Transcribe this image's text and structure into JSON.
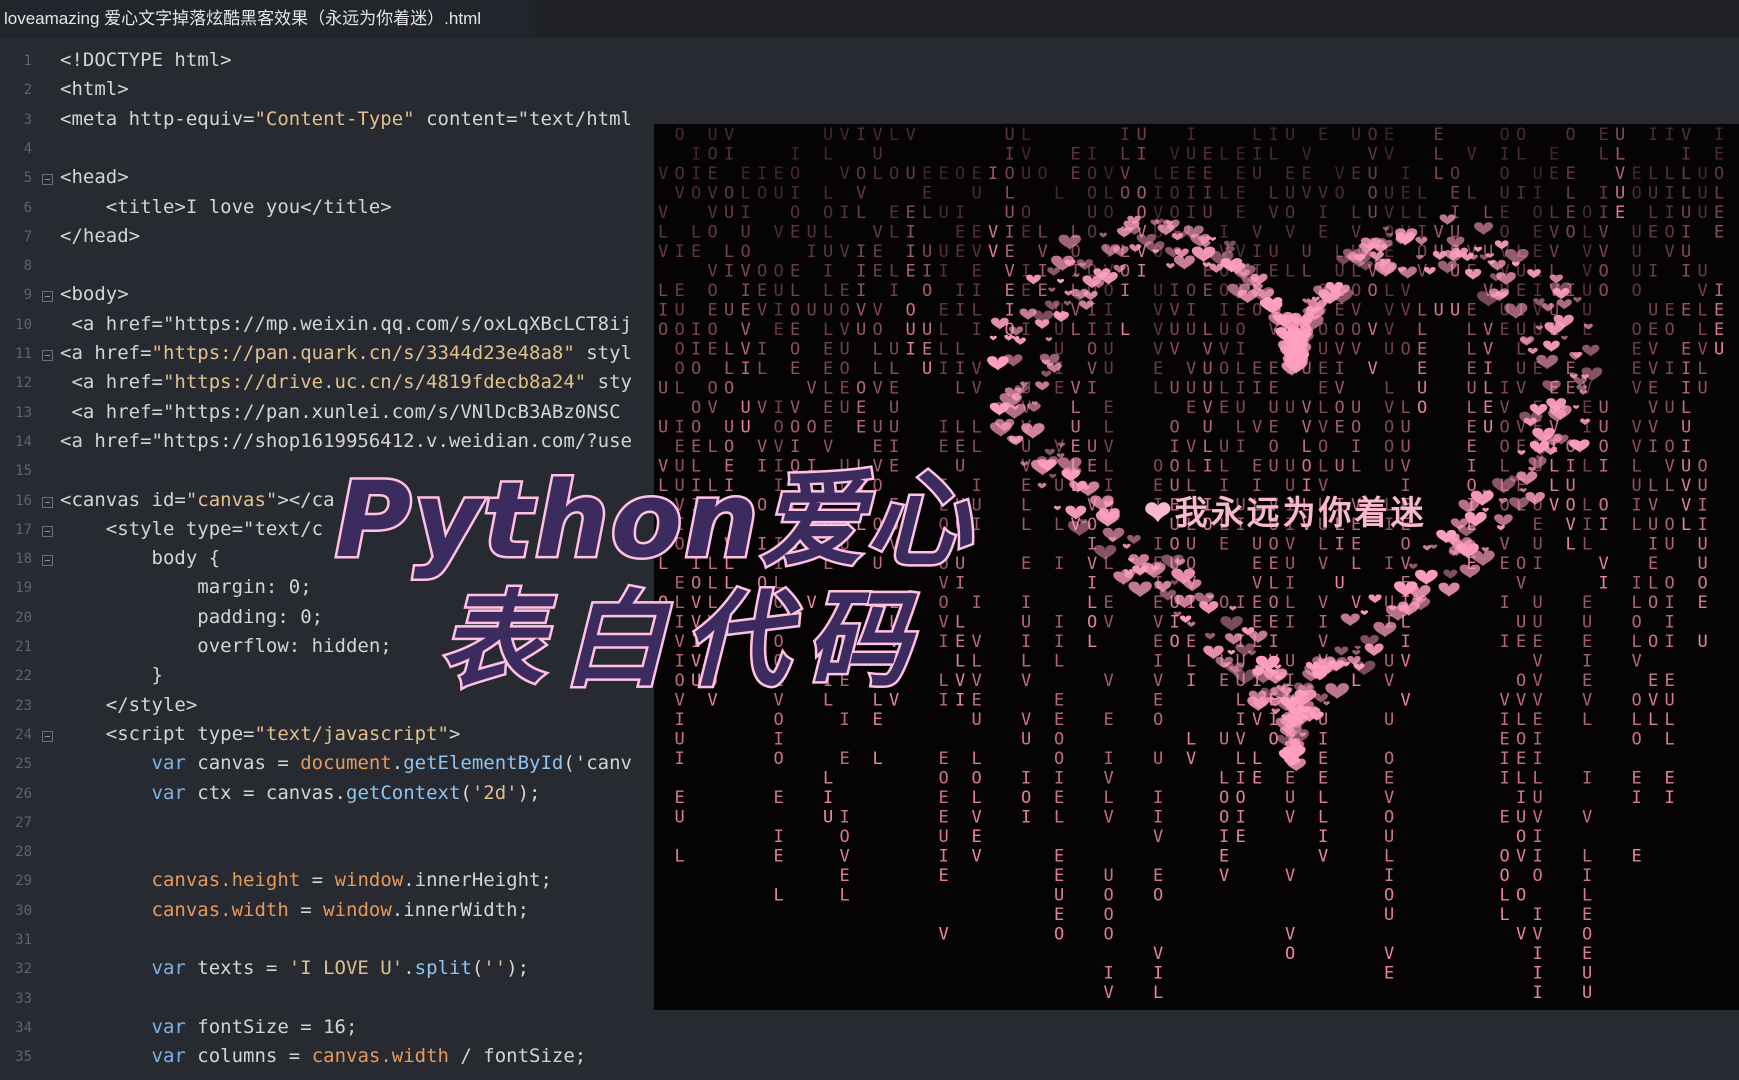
{
  "tab": {
    "title": "loveamazing 爱心文字掉落炫酷黑客效果（永远为你着迷）.html"
  },
  "code_lines": [
    {
      "n": "1",
      "t": "<!DOCTYPE html>"
    },
    {
      "n": "2",
      "t": "<html>"
    },
    {
      "n": "3",
      "t": "<meta http-equiv=\"Content-Type\" content=\"text/html"
    },
    {
      "n": "4",
      "t": ""
    },
    {
      "n": "5",
      "t": "<head>"
    },
    {
      "n": "6",
      "t": "    <title>I love you</title>"
    },
    {
      "n": "7",
      "t": "</head>"
    },
    {
      "n": "8",
      "t": ""
    },
    {
      "n": "9",
      "t": "<body>"
    },
    {
      "n": "10",
      "t": " <a href=\"https://mp.weixin.qq.com/s/oxLqXBcLCT8ij"
    },
    {
      "n": "11",
      "t": "<a href=\"https://pan.quark.cn/s/3344d23e48a8\" styl"
    },
    {
      "n": "12",
      "t": " <a href=\"https://drive.uc.cn/s/4819fdecb8a24\" sty"
    },
    {
      "n": "13",
      "t": " <a href=\"https://pan.xunlei.com/s/VNlDcB3ABz0NSC"
    },
    {
      "n": "14",
      "t": "<a href=\"https://shop1619956412.v.weidian.com/?use"
    },
    {
      "n": "15",
      "t": ""
    },
    {
      "n": "16",
      "t": "<canvas id=\"canvas\"></ca"
    },
    {
      "n": "17",
      "t": "    <style type=\"text/c"
    },
    {
      "n": "18",
      "t": "        body {"
    },
    {
      "n": "19",
      "t": "            margin: 0;"
    },
    {
      "n": "20",
      "t": "            padding: 0;"
    },
    {
      "n": "21",
      "t": "            overflow: hidden;"
    },
    {
      "n": "22",
      "t": "        }"
    },
    {
      "n": "23",
      "t": "    </style>"
    },
    {
      "n": "24",
      "t": "    <script type=\"text/javascript\">"
    },
    {
      "n": "25",
      "t": "        var canvas = document.getElementById('canv"
    },
    {
      "n": "26",
      "t": "        var ctx = canvas.getContext('2d');"
    },
    {
      "n": "27",
      "t": ""
    },
    {
      "n": "28",
      "t": ""
    },
    {
      "n": "29",
      "t": "        canvas.height = window.innerHeight;"
    },
    {
      "n": "30",
      "t": "        canvas.width = window.innerWidth;"
    },
    {
      "n": "31",
      "t": ""
    },
    {
      "n": "32",
      "t": "        var texts = 'I LOVE U'.split('');"
    },
    {
      "n": "33",
      "t": ""
    },
    {
      "n": "34",
      "t": "        var fontSize = 16;"
    },
    {
      "n": "35",
      "t": "        var columns = canvas.width / fontSize;"
    }
  ],
  "preview": {
    "message": "❤我永远为你着迷",
    "rain_chars": "ILOVEU"
  },
  "overlay": {
    "line1": "Python爱心",
    "line2": "表白代码"
  },
  "colors": {
    "editor_bg": "#272a30",
    "rain": "#f08aa2",
    "heart": "#ff9fbf",
    "title_fill": "#3c2b5e",
    "title_stroke": "#ffc2e3"
  }
}
